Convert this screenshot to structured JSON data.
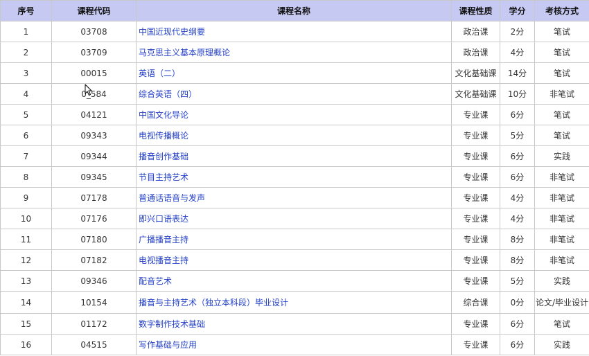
{
  "headers": {
    "index": "序号",
    "code": "课程代码",
    "name": "课程名称",
    "type": "课程性质",
    "credit": "学分",
    "exam": "考核方式"
  },
  "rows": [
    {
      "index": "1",
      "code": "03708",
      "name": "中国近现代史纲要",
      "type": "政治课",
      "credit": "2分",
      "exam": "笔试"
    },
    {
      "index": "2",
      "code": "03709",
      "name": "马克思主义基本原理概论",
      "type": "政治课",
      "credit": "4分",
      "exam": "笔试"
    },
    {
      "index": "3",
      "code": "00015",
      "name": "英语（二）",
      "type": "文化基础课",
      "credit": "14分",
      "exam": "笔试"
    },
    {
      "index": "4",
      "code": "0_584",
      "name": "综合英语（四）",
      "type": "文化基础课",
      "credit": "10分",
      "exam": "非笔试"
    },
    {
      "index": "5",
      "code": "04121",
      "name": "中国文化导论",
      "type": "专业课",
      "credit": "6分",
      "exam": "笔试"
    },
    {
      "index": "6",
      "code": "09343",
      "name": "电视传播概论",
      "type": "专业课",
      "credit": "5分",
      "exam": "笔试"
    },
    {
      "index": "7",
      "code": "09344",
      "name": "播音创作基础",
      "type": "专业课",
      "credit": "6分",
      "exam": "实践"
    },
    {
      "index": "8",
      "code": "09345",
      "name": "节目主持艺术",
      "type": "专业课",
      "credit": "6分",
      "exam": "非笔试"
    },
    {
      "index": "9",
      "code": "07178",
      "name": "普通话语音与发声",
      "type": "专业课",
      "credit": "4分",
      "exam": "非笔试"
    },
    {
      "index": "10",
      "code": "07176",
      "name": "即兴口语表达",
      "type": "专业课",
      "credit": "4分",
      "exam": "非笔试"
    },
    {
      "index": "11",
      "code": "07180",
      "name": "广播播音主持",
      "type": "专业课",
      "credit": "8分",
      "exam": "非笔试"
    },
    {
      "index": "12",
      "code": "07182",
      "name": "电视播音主持",
      "type": "专业课",
      "credit": "8分",
      "exam": "非笔试"
    },
    {
      "index": "13",
      "code": "09346",
      "name": "配音艺术",
      "type": "专业课",
      "credit": "5分",
      "exam": "实践"
    },
    {
      "index": "14",
      "code": "10154",
      "name": "播音与主持艺术（独立本科段）毕业设计",
      "type": "综合课",
      "credit": "0分",
      "exam": "论文/毕业设计"
    },
    {
      "index": "15",
      "code": "01172",
      "name": "数字制作技术基础",
      "type": "专业课",
      "credit": "6分",
      "exam": "笔试"
    },
    {
      "index": "16",
      "code": "04515",
      "name": "写作基础与应用",
      "type": "专业课",
      "credit": "6分",
      "exam": "实践"
    }
  ],
  "colors": {
    "header_bg": "#c6c9f2",
    "link": "#2340c8",
    "border": "#c8c8c8"
  },
  "icons": {
    "cursor": "mouse-pointer-icon"
  }
}
